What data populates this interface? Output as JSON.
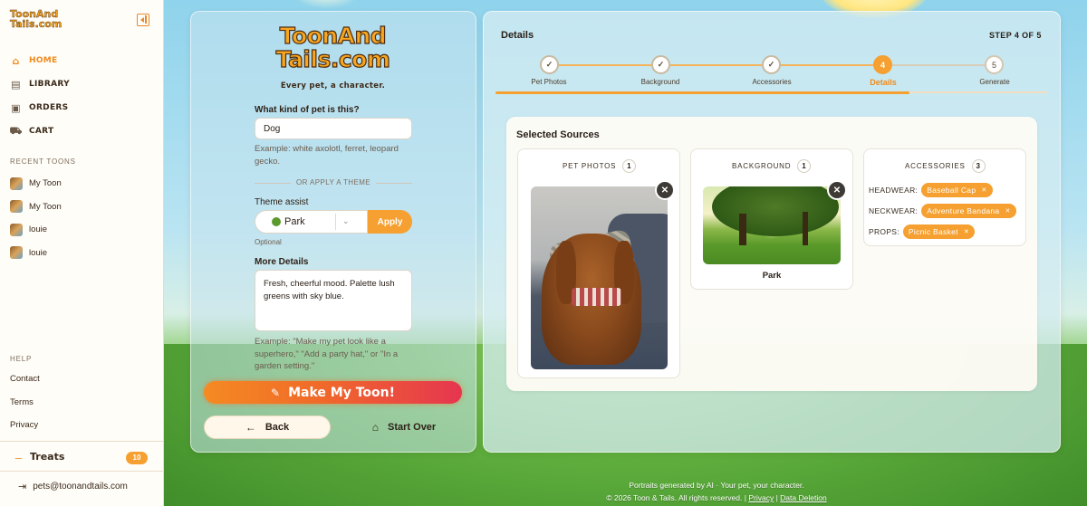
{
  "brand": {
    "logo_line1": "ToonAnd",
    "logo_line2": "Tails.com",
    "tagline": "Every pet, a character."
  },
  "sidebar": {
    "nav": [
      {
        "label": "HOME",
        "icon": "home-icon",
        "active": true
      },
      {
        "label": "LIBRARY",
        "icon": "library-icon",
        "active": false
      },
      {
        "label": "ORDERS",
        "icon": "box-icon",
        "active": false
      },
      {
        "label": "CART",
        "icon": "cart-icon",
        "active": false
      }
    ],
    "recent_title": "RECENT TOONS",
    "recent": [
      {
        "label": "My Toon"
      },
      {
        "label": "My Toon"
      },
      {
        "label": "louie"
      },
      {
        "label": "louie"
      }
    ],
    "help_title": "HELP",
    "help": [
      {
        "label": "Contact"
      },
      {
        "label": "Terms"
      },
      {
        "label": "Privacy"
      }
    ],
    "treats_label": "Treats",
    "treats_count": "10",
    "email": "pets@toonandtails.com"
  },
  "form": {
    "pet_kind_label": "What kind of pet is this?",
    "pet_kind_value": "Dog",
    "pet_kind_hint": "Example: white axolotl, ferret, leopard gecko.",
    "or_theme": "OR APPLY A THEME",
    "theme_label": "Theme assist",
    "theme_value": "Park",
    "apply_label": "Apply",
    "optional": "Optional",
    "more_label": "More Details",
    "more_value": "Fresh, cheerful mood. Palette lush greens with sky blue.",
    "more_hint": "Example: \"Make my pet look like a superhero,\" \"Add a party hat,\" or \"In a garden setting.\"",
    "make_label": "Make My Toon!",
    "back_label": "Back",
    "start_over_label": "Start Over"
  },
  "details": {
    "title": "Details",
    "step_of": "STEP 4 OF 5",
    "steps": [
      {
        "num": "✓",
        "label": "Pet Photos",
        "state": "done"
      },
      {
        "num": "✓",
        "label": "Background",
        "state": "done"
      },
      {
        "num": "✓",
        "label": "Accessories",
        "state": "done"
      },
      {
        "num": "4",
        "label": "Details",
        "state": "active"
      },
      {
        "num": "5",
        "label": "Generate",
        "state": "todo"
      }
    ],
    "sources_title": "Selected Sources",
    "pet_photos": {
      "label": "PET PHOTOS",
      "count": "1"
    },
    "background": {
      "label": "BACKGROUND",
      "count": "1",
      "caption": "Park"
    },
    "accessories": {
      "label": "ACCESSORIES",
      "count": "3",
      "items": [
        {
          "category": "HEADWEAR:",
          "value": "Baseball Cap"
        },
        {
          "category": "NECKWEAR:",
          "value": "Adventure Bandana"
        },
        {
          "category": "PROPS:",
          "value": "Picnic Basket"
        }
      ]
    }
  },
  "footer": {
    "line1": "Portraits generated by AI · Your pet, your character.",
    "copyright": "© 2026 Toon & Tails. All rights reserved. |",
    "privacy": "Privacy",
    "pipe": "|",
    "deletion": "Data Deletion"
  },
  "colors": {
    "accent": "#f5a030",
    "cta_start": "#f58a22",
    "cta_end": "#e63550"
  }
}
